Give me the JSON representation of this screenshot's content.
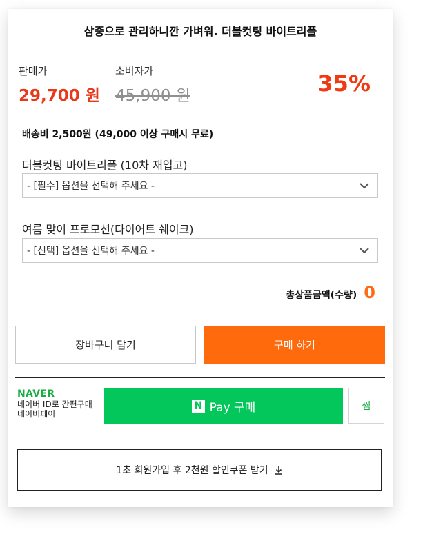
{
  "product": {
    "title": "삼중으로 관리하니깐 가벼워. 더블컷팅 바이트리플"
  },
  "price": {
    "sale_label": "판매가",
    "sale_value": "29,700 원",
    "consumer_label": "소비자가",
    "consumer_value": "45,900 원",
    "discount": "35%"
  },
  "shipping": "배송비 2,500원 (49,000 이상 구매시 무료)",
  "options": [
    {
      "label": "더블컷팅 바이트리플 (10차 재입고)",
      "value": "- [필수] 옵션을 선택해 주세요 -"
    },
    {
      "label": "여름 맞이 프로모션(다이어트 쉐이크)",
      "value": "- [선택] 옵션을 선택해 주세요 -"
    }
  ],
  "total": {
    "label": "총상품금액(수량)",
    "count": "0"
  },
  "buttons": {
    "cart": "장바구니 담기",
    "buy": "구매 하기"
  },
  "naver": {
    "logo": "NAVER",
    "desc": "네이버 ID로 간편구매",
    "sub": "네이버페이",
    "pay_n": "N",
    "pay_label": "Pay 구매",
    "zzim": "찜"
  },
  "coupon": "1초 회원가입 후 2천원 할인쿠폰 받기",
  "colors": {
    "price_red": "#e8381a",
    "discount_red": "#ee3b13",
    "buy_orange": "#ff6a0c",
    "count_orange": "#ff6a13",
    "naver_green": "#03c75a",
    "naver_text_green": "#19ac44"
  },
  "icons": {
    "select_arrow": "chevron-down-icon",
    "coupon": "download-icon"
  }
}
